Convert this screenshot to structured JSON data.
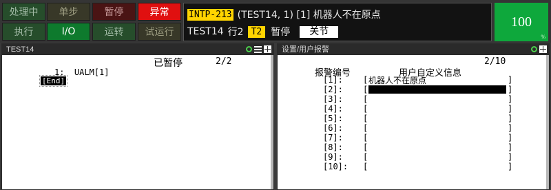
{
  "status_buttons": {
    "busy": "处理中",
    "step": "单步",
    "hold": "暂停",
    "fault": "异常",
    "run": "执行",
    "io": "I/O",
    "prod": "运转",
    "tcyc": "试运行"
  },
  "alarm": {
    "code": "INTP-213",
    "text": "(TEST14, 1) [1] 机器人不在原点",
    "program": "TEST14",
    "line": "行2",
    "mode": "T2",
    "state": "暂停",
    "close_label": "关节"
  },
  "override": {
    "value": "100",
    "unit": "%"
  },
  "left_panel": {
    "title": "TEST14",
    "status": "已暂停",
    "page": "2/2",
    "line1_num": "1:",
    "line1_code": "UALM[1]",
    "end_label": "[End]"
  },
  "right_panel": {
    "title": "设置/用户报警",
    "page": "2/10",
    "col_num": "报警编号",
    "col_msg": "用户自定义信息",
    "rows": [
      {
        "num": "[1]:",
        "msg": "机器人不在原点"
      },
      {
        "num": "[2]:",
        "msg": ""
      },
      {
        "num": "[3]:",
        "msg": ""
      },
      {
        "num": "[4]:",
        "msg": ""
      },
      {
        "num": "[5]:",
        "msg": ""
      },
      {
        "num": "[6]:",
        "msg": ""
      },
      {
        "num": "[7]:",
        "msg": ""
      },
      {
        "num": "[8]:",
        "msg": ""
      },
      {
        "num": "[9]:",
        "msg": ""
      },
      {
        "num": "[10]:",
        "msg": ""
      }
    ],
    "bracket_open": "[",
    "bracket_close": "]"
  },
  "colors": {
    "accent_yellow": "#ffd400",
    "fault_red": "#e01010",
    "io_green": "#0e7a2d",
    "override_green": "#0ea83c"
  }
}
